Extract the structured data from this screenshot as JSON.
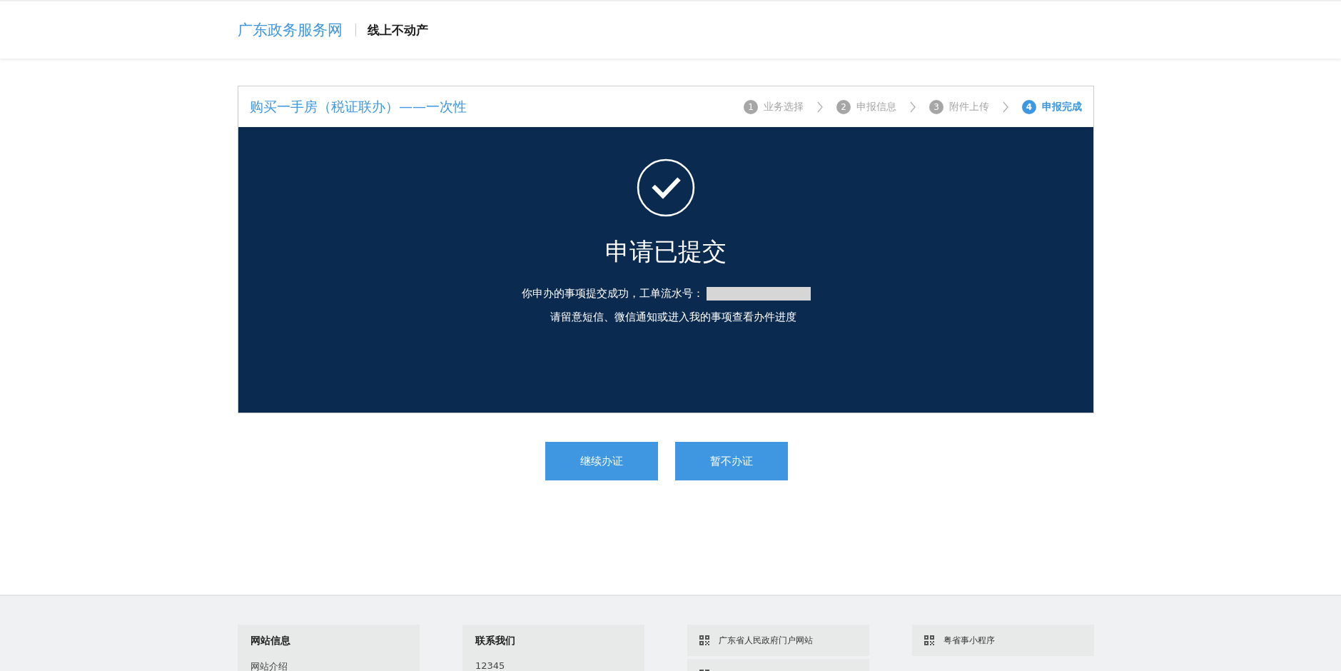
{
  "header": {
    "site_name": "广东政务服务网",
    "section": "线上不动产"
  },
  "card": {
    "title": "购买一手房（税证联办）——一次性",
    "steps": [
      {
        "number": "1",
        "label": "业务选择",
        "selected": false
      },
      {
        "number": "2",
        "label": "申报信息",
        "selected": false
      },
      {
        "number": "3",
        "label": "附件上传",
        "selected": false
      },
      {
        "number": "4",
        "label": "申报完成",
        "selected": true
      }
    ]
  },
  "result": {
    "heading": "申请已提交",
    "message": "你申办的事项提交成功，工单流水号：",
    "serial_redacted": true,
    "hint": "请留意短信、微信通知或进入我的事项查看办件进度"
  },
  "buttons": [
    "继续办证",
    "暂不办证"
  ],
  "footer": {
    "columns": [
      {
        "kind": "info",
        "title": "网站信息",
        "items": [
          "网站介绍"
        ]
      },
      {
        "kind": "info",
        "title": "联系我们",
        "items": [
          "12345"
        ]
      },
      {
        "kind": "qr",
        "items": [
          {
            "label": "广东省人民政府门户网站"
          },
          {
            "cut_off": true
          }
        ]
      },
      {
        "kind": "qr",
        "items": [
          {
            "label": "粤省事小程序"
          }
        ]
      }
    ]
  }
}
